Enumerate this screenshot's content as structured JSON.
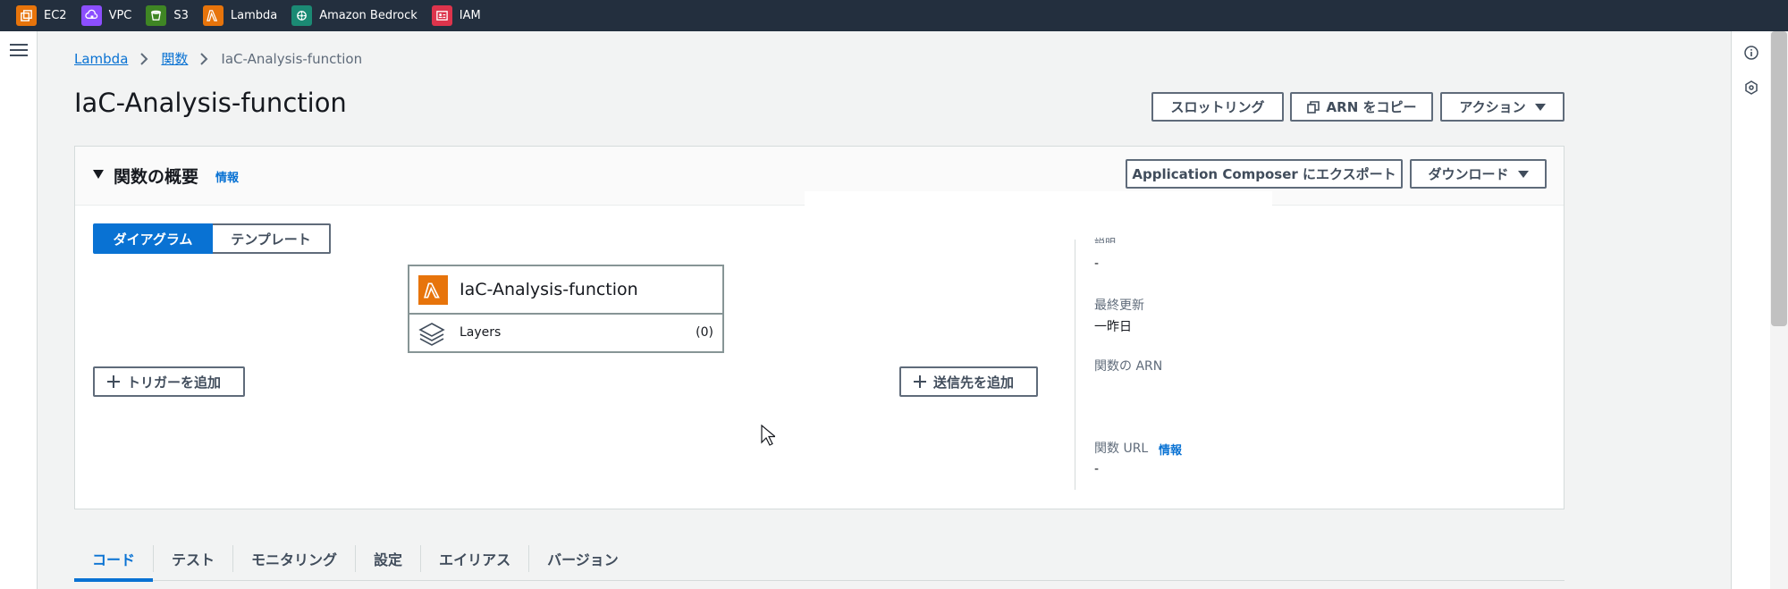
{
  "topbar": {
    "favorites": [
      {
        "label": "EC2",
        "icon": "ec2-icon",
        "color": "#e7740b"
      },
      {
        "label": "VPC",
        "icon": "vpc-icon",
        "color": "#8c4fff"
      },
      {
        "label": "S3",
        "icon": "s3-icon",
        "color": "#3f8624"
      },
      {
        "label": "Lambda",
        "icon": "lambda-icon",
        "color": "#e7740b"
      },
      {
        "label": "Amazon Bedrock",
        "icon": "bedrock-icon",
        "color": "#1b8a74"
      },
      {
        "label": "IAM",
        "icon": "iam-icon",
        "color": "#dd344c"
      }
    ]
  },
  "breadcrumb": {
    "items": [
      "Lambda",
      "関数"
    ],
    "current": "IaC-Analysis-function"
  },
  "page": {
    "title": "IaC-Analysis-function"
  },
  "header_actions": {
    "throttle": "スロットリング",
    "copy_arn": "ARN をコピー",
    "actions": "アクション"
  },
  "overview": {
    "title": "関数の概要",
    "info": "情報",
    "export": "Application Composer にエクスポート",
    "download": "ダウンロード",
    "view_tabs": [
      "ダイアグラム",
      "テンプレート"
    ],
    "function_name": "IaC-Analysis-function",
    "layers_label": "Layers",
    "layers_count": "(0)",
    "add_trigger": "トリガーを追加",
    "add_destination": "送信先を追加",
    "details": {
      "description_label": "説明",
      "description_value": "-",
      "last_modified_label": "最終更新",
      "last_modified_value": "一昨日",
      "arn_label": "関数の ARN",
      "url_label": "関数 URL",
      "url_info": "情報",
      "url_value": "-"
    }
  },
  "tabs": [
    "コード",
    "テスト",
    "モニタリング",
    "設定",
    "エイリアス",
    "バージョン"
  ],
  "colors": {
    "accent": "#0972d3",
    "nav_bg": "#232f3e",
    "lambda": "#e7740b"
  }
}
